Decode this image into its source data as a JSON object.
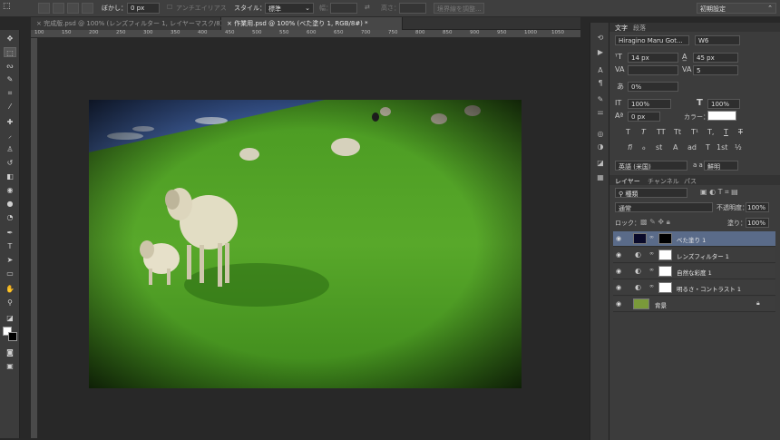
{
  "options_bar": {
    "feather_label": "ぼかし：",
    "feather_value": "0 px",
    "antialias_label": "アンチエイリアス",
    "style_label": "スタイル：",
    "style_value": "標準",
    "width_label": "幅：",
    "height_label": "高さ：",
    "refine_edge": "境界線を調整...",
    "workspace": "初期設定"
  },
  "tabs": [
    {
      "label": "完成版.psd @ 100% (レンズフィルター 1, レイヤーマスク/8)",
      "active": false
    },
    {
      "label": "作業用.psd @ 100% (べた塗り 1, RGB/8#) *",
      "active": true
    }
  ],
  "ruler_ticks": [
    "100",
    "150",
    "200",
    "250",
    "300",
    "350",
    "400",
    "450",
    "500",
    "550",
    "600",
    "650",
    "700",
    "750",
    "800",
    "850",
    "900",
    "950",
    "1000",
    "1050"
  ],
  "character_panel": {
    "tabs": [
      "文字",
      "段落"
    ],
    "font_family": "Hiragino Maru Got...",
    "font_weight": "W6",
    "font_size": "14 px",
    "leading": "45 px",
    "kerning": "",
    "tracking": "5",
    "tsume": "0%",
    "vertical_scale": "100%",
    "horizontal_scale": "100%",
    "baseline_shift": "0 px",
    "color_label": "カラー：",
    "text_color": "#ffffff",
    "style_buttons": [
      "T",
      "T",
      "TT",
      "Tt",
      "T¹",
      "T,",
      "T",
      "T"
    ],
    "opentype_buttons": [
      "fi",
      "ℴ",
      "st",
      "A",
      "ad",
      "T",
      "1st",
      "½"
    ],
    "language": "英語 (米国)",
    "aa_label": "a a",
    "antialias": "鮮明"
  },
  "layers_panel": {
    "tabs": [
      "レイヤー",
      "チャンネル",
      "パス"
    ],
    "filter_kind": "種類",
    "blend_mode": "通常",
    "opacity_label": "不透明度：",
    "opacity": "100%",
    "lock_label": "ロック：",
    "fill_label": "塗り：",
    "fill": "100%",
    "layers": [
      {
        "name": "べた塗り 1",
        "selected": true,
        "thumb_color": "#0a0a2a",
        "mask_color": "#000000",
        "icon": "fill-icon"
      },
      {
        "name": "レンズフィルター 1",
        "selected": false,
        "thumb_color": "#ffffff",
        "mask_color": "#ffffff",
        "icon": "adjustment-icon"
      },
      {
        "name": "自然な彩度 1",
        "selected": false,
        "thumb_color": "#ffffff",
        "mask_color": "#ffffff",
        "icon": "adjustment-icon"
      },
      {
        "name": "明るさ・コントラスト 1",
        "selected": false,
        "thumb_color": "#ffffff",
        "mask_color": "#ffffff",
        "icon": "adjustment-icon"
      },
      {
        "name": "背景",
        "selected": false,
        "thumb_color": "#7a9a3a",
        "mask_color": "",
        "icon": "lock-icon"
      }
    ]
  },
  "colors": {
    "accent": "#5a6b89",
    "panel": "#3c3c3c",
    "grass": "#4a9a20"
  }
}
